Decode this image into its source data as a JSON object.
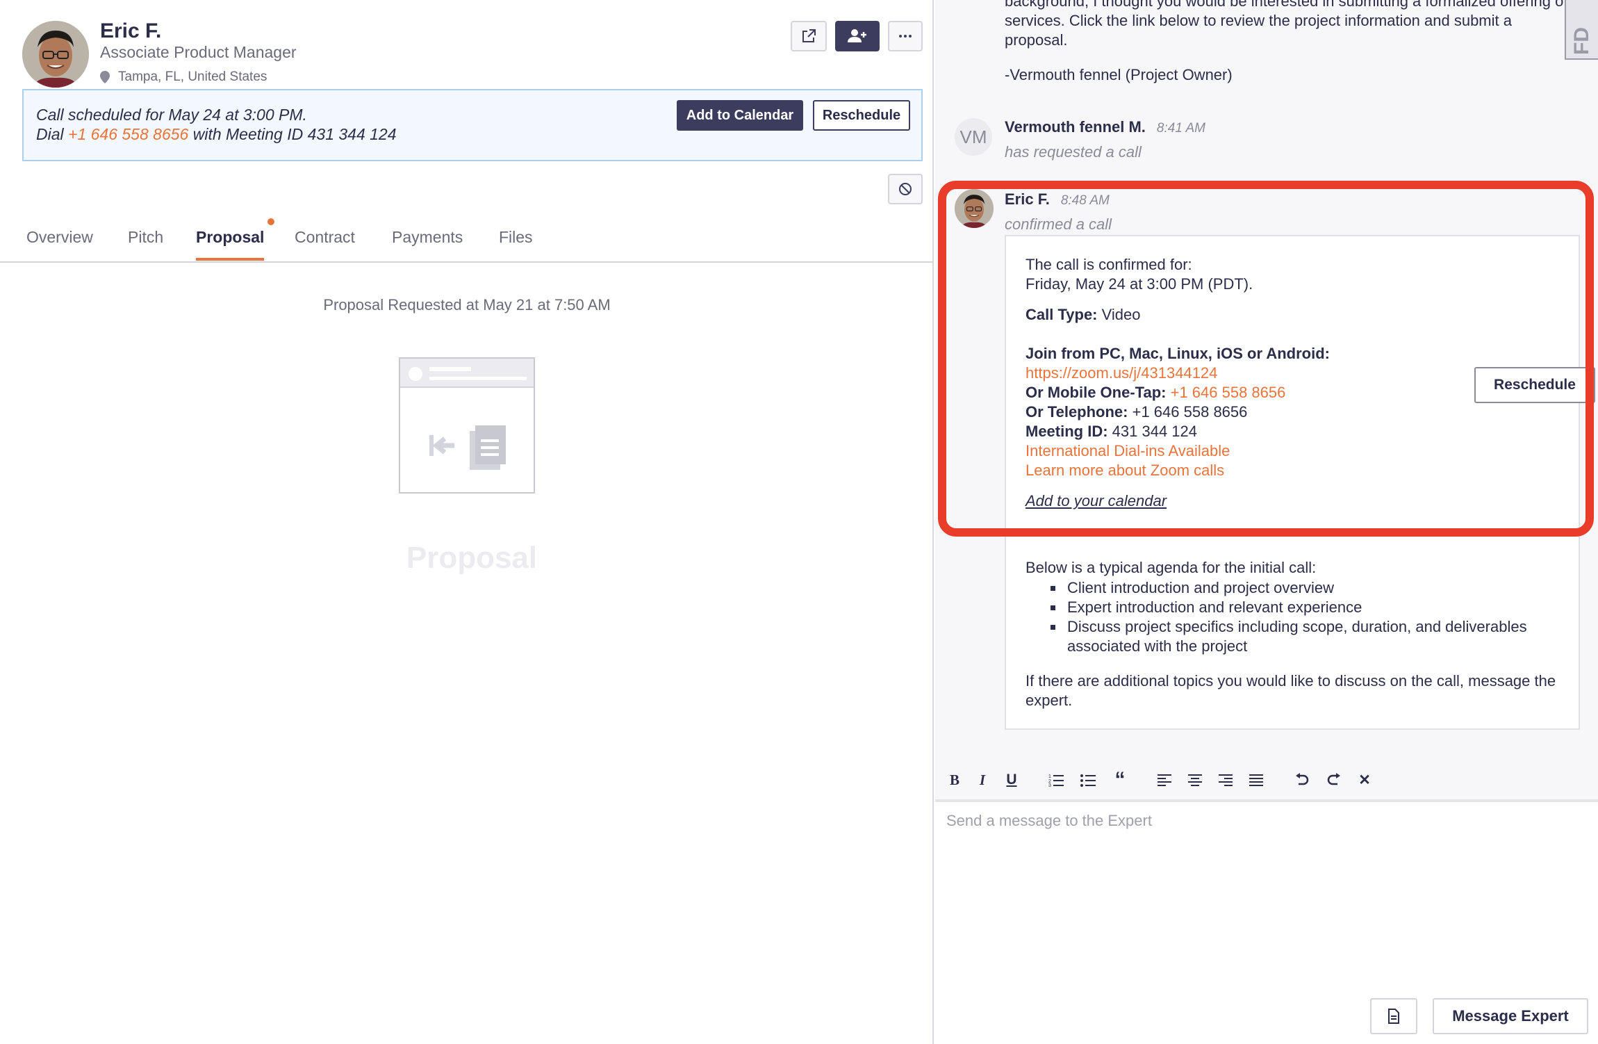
{
  "profile": {
    "name": "Eric F.",
    "title": "Associate Product Manager",
    "location": "Tampa, FL, United States"
  },
  "call_banner": {
    "line1": "Call scheduled for May 24 at 3:00 PM.",
    "line2_prefix": "Dial ",
    "phone": "+1 646 558 8656",
    "line2_suffix": " with Meeting ID 431 344 124",
    "add_to_calendar_label": "Add to Calendar",
    "reschedule_label": "Reschedule"
  },
  "tabs": [
    {
      "label": "Overview"
    },
    {
      "label": "Pitch"
    },
    {
      "label": "Proposal"
    },
    {
      "label": "Contract"
    },
    {
      "label": "Payments"
    },
    {
      "label": "Files"
    }
  ],
  "proposal": {
    "requested_text": "Proposal Requested at May 21 at 7:50 AM",
    "placeholder_title": "Proposal"
  },
  "messages": {
    "intro_partial": "background, I thought you would be interested in submitting a formalized offering of services. Click the link below to review the project information and submit a proposal.",
    "signature": "-Vermouth fennel (Project Owner)",
    "vm": {
      "initials": "VM",
      "sender": "Vermouth fennel M.",
      "time": "8:41 AM",
      "action": "has requested a call"
    },
    "eric": {
      "sender": "Eric F.",
      "time": "8:48 AM",
      "action": "confirmed a call"
    }
  },
  "card": {
    "confirmed_line1": "The call is confirmed for:",
    "confirmed_line2": "Friday, May 24 at 3:00 PM (PDT).",
    "call_type_label": "Call Type:",
    "call_type_value": " Video",
    "join_label": "Join from PC, Mac, Linux, iOS or Android:",
    "zoom_url": "https://zoom.us/j/431344124",
    "mobile_label": "Or Mobile One-Tap:",
    "mobile_value": " +1 646 558 8656",
    "telephone_label": "Or Telephone:",
    "telephone_value": " +1 646 558 8656",
    "meeting_label": "Meeting ID:",
    "meeting_value": " 431 344 124",
    "intl_link": "International Dial-ins Available",
    "learn_link": "Learn more about Zoom calls",
    "calendar_link": "Add to your calendar",
    "reschedule_label": "Reschedule",
    "agenda_intro": "Below is a typical agenda for the initial call:",
    "agenda": [
      {
        "text": "Client introduction and project overview"
      },
      {
        "text": "Expert introduction and relevant experience"
      },
      {
        "text": "Discuss project specifics including scope, duration, and deliverables associated with the project"
      }
    ],
    "closing": "If there are additional topics you would like to discuss on the call, message the expert."
  },
  "composer": {
    "placeholder": "Send a message to the Expert",
    "send_label": "Message Expert"
  },
  "side_tab_label": "FD",
  "colors": {
    "accent": "#e8743b",
    "dark": "#3c3d5e",
    "highlight": "#ea3c2a"
  }
}
